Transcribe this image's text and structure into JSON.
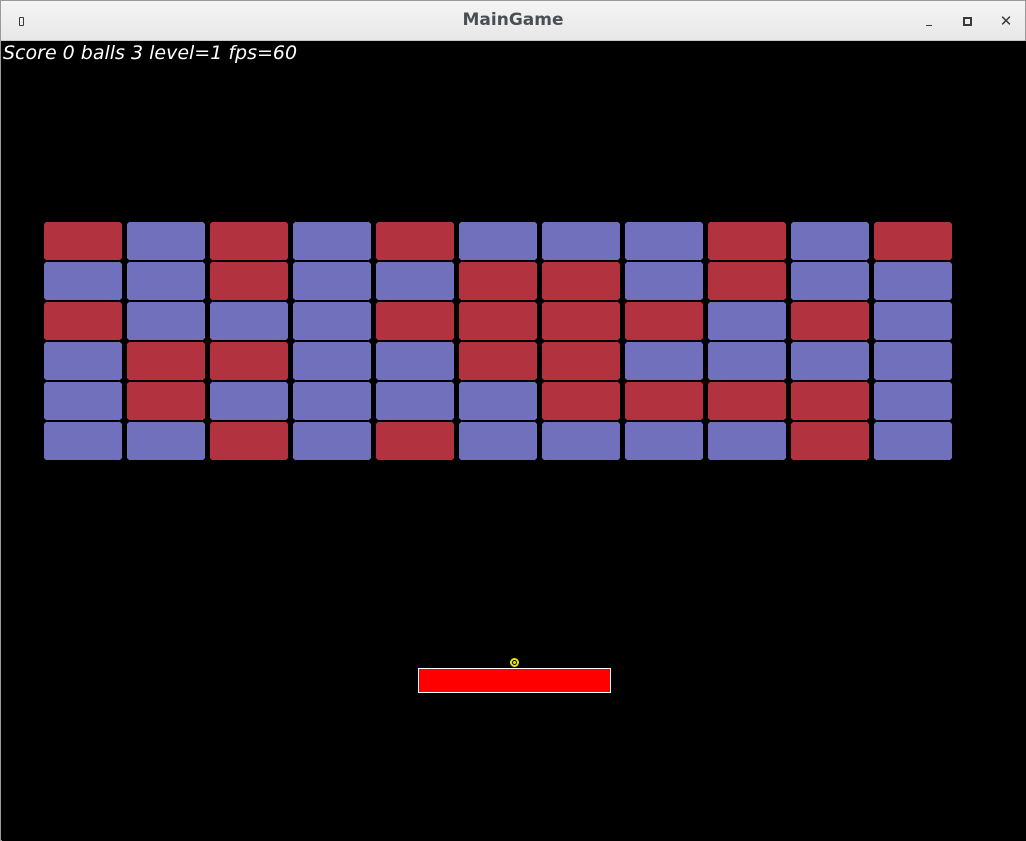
{
  "window": {
    "title": "MainGame",
    "controls": {
      "close_glyph": "✕"
    }
  },
  "hud": {
    "text": "Score 0 balls 3 level=1 fps=60"
  },
  "colors": {
    "red_brick": "#b2323f",
    "blue_brick": "#7170bd",
    "paddle": "#ff0000",
    "ball": "#e8e800",
    "background": "#000000"
  },
  "bricks": {
    "rows": [
      [
        "red",
        "blue",
        "red",
        "blue",
        "red",
        "blue",
        "blue",
        "blue",
        "red",
        "blue",
        "red"
      ],
      [
        "blue",
        "blue",
        "red",
        "blue",
        "blue",
        "red",
        "red",
        "blue",
        "red",
        "blue",
        "blue"
      ],
      [
        "red",
        "blue",
        "blue",
        "blue",
        "red",
        "red",
        "red",
        "red",
        "blue",
        "red",
        "blue"
      ],
      [
        "blue",
        "red",
        "red",
        "blue",
        "blue",
        "red",
        "red",
        "blue",
        "blue",
        "blue",
        "blue"
      ],
      [
        "blue",
        "red",
        "blue",
        "blue",
        "blue",
        "blue",
        "red",
        "red",
        "red",
        "red",
        "blue"
      ],
      [
        "blue",
        "blue",
        "red",
        "blue",
        "red",
        "blue",
        "blue",
        "blue",
        "blue",
        "red",
        "blue"
      ]
    ]
  }
}
